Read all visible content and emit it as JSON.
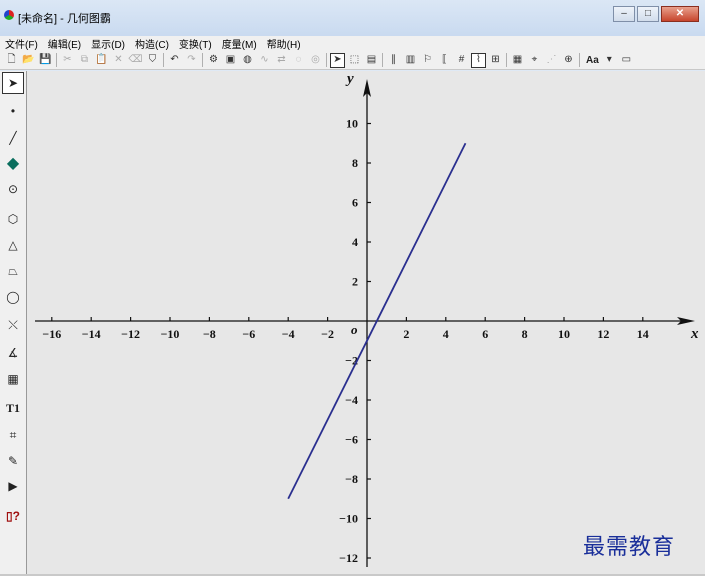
{
  "window": {
    "title": "[未命名] - 几何图霸",
    "minimize_glyph": "–",
    "maximize_glyph": "□",
    "close_glyph": "✕"
  },
  "menu": [
    {
      "label": "文件(F)"
    },
    {
      "label": "编辑(E)"
    },
    {
      "label": "显示(D)"
    },
    {
      "label": "构造(C)"
    },
    {
      "label": "变换(T)"
    },
    {
      "label": "度量(M)"
    },
    {
      "label": "帮助(H)"
    }
  ],
  "toolbar": {
    "font_button_label": "Aa",
    "groups": [
      [
        {
          "name": "new-file-icon",
          "glyph": "🗋"
        },
        {
          "name": "open-file-icon",
          "glyph": "📂"
        },
        {
          "name": "save-icon",
          "glyph": "💾"
        }
      ],
      [
        {
          "name": "cut-icon",
          "glyph": "✂",
          "disabled": true
        },
        {
          "name": "copy-icon",
          "glyph": "⧉",
          "disabled": true
        },
        {
          "name": "paste-icon",
          "glyph": "📋",
          "disabled": true
        },
        {
          "name": "delete-icon",
          "glyph": "✕",
          "disabled": true
        },
        {
          "name": "eraser-icon",
          "glyph": "⌫",
          "disabled": true
        },
        {
          "name": "shield-icon",
          "glyph": "⛉"
        }
      ],
      [
        {
          "name": "undo-icon",
          "glyph": "↶"
        },
        {
          "name": "redo-icon",
          "glyph": "↷",
          "disabled": true
        }
      ],
      [
        {
          "name": "gear-icon",
          "glyph": "⚙"
        },
        {
          "name": "image-settings-icon",
          "glyph": "▣"
        },
        {
          "name": "animate-icon",
          "glyph": "◍"
        },
        {
          "name": "trace-icon",
          "glyph": "∿",
          "disabled": true
        },
        {
          "name": "movement-icon",
          "glyph": "⇄",
          "disabled": true
        },
        {
          "name": "hide-icon",
          "glyph": "◌",
          "disabled": true
        },
        {
          "name": "show-icon",
          "glyph": "◎",
          "disabled": true
        }
      ],
      [
        {
          "name": "select-arrow-icon",
          "glyph": "➤",
          "active": true
        },
        {
          "name": "select-region-icon",
          "glyph": "⬚"
        },
        {
          "name": "select-all-icon",
          "glyph": "▤"
        }
      ],
      [
        {
          "name": "parallel-lines-icon",
          "glyph": "∥"
        },
        {
          "name": "page-icon",
          "glyph": "▥"
        },
        {
          "name": "label-icon",
          "glyph": "⚐"
        },
        {
          "name": "bracket-icon",
          "glyph": "⟦"
        },
        {
          "name": "number-icon",
          "glyph": "#"
        },
        {
          "name": "function-graph-icon",
          "glyph": "⌇",
          "active": true
        },
        {
          "name": "grid-icon",
          "glyph": "⊞"
        }
      ],
      [
        {
          "name": "calculator-icon",
          "glyph": "▦"
        },
        {
          "name": "coordinate-icon",
          "glyph": "⌖"
        },
        {
          "name": "dotted-line-icon",
          "glyph": "⋰",
          "disabled": true
        },
        {
          "name": "locus-icon",
          "glyph": "⊕"
        }
      ],
      [
        {
          "name": "dropdown-arrow-icon",
          "glyph": "▾"
        },
        {
          "name": "window-icon",
          "glyph": "▭"
        }
      ]
    ]
  },
  "sidebar_tools": [
    {
      "name": "select-tool-icon",
      "glyph": "➤",
      "active": true
    },
    {
      "name": "point-tool-icon",
      "glyph": "•"
    },
    {
      "name": "line-tool-icon",
      "glyph": "╱"
    },
    {
      "name": "polygon-tool-icon",
      "glyph": "◆"
    },
    {
      "name": "circle-tool-icon",
      "glyph": "⊙"
    },
    {
      "name": "cube-tool-icon",
      "glyph": "⬡"
    },
    {
      "name": "pyramid-tool-icon",
      "glyph": "△"
    },
    {
      "name": "prism-tool-icon",
      "glyph": "⏢"
    },
    {
      "name": "sphere-tool-icon",
      "glyph": "◯"
    },
    {
      "name": "transform-tool-icon",
      "glyph": "⤬"
    },
    {
      "name": "angle-tool-icon",
      "glyph": "∡"
    },
    {
      "name": "calculator-tool-icon",
      "glyph": "▦"
    },
    {
      "name": "text-tool-icon",
      "glyph": "T1"
    },
    {
      "name": "measure-tool-icon",
      "glyph": "⌗"
    },
    {
      "name": "pencil-tool-icon",
      "glyph": "✎"
    },
    {
      "name": "play-tool-icon",
      "glyph": "▶"
    },
    {
      "name": "help-tool-icon",
      "glyph": "▯?"
    }
  ],
  "graph": {
    "x_axis_label": "x",
    "y_axis_label": "y",
    "origin_label": "o",
    "x_ticks": [
      -16,
      -14,
      -12,
      -10,
      -8,
      -6,
      -4,
      -2,
      2,
      4,
      6,
      8,
      10,
      12,
      14
    ],
    "y_ticks": [
      10,
      8,
      6,
      4,
      2,
      -2,
      -4,
      -6,
      -8,
      -10,
      -12
    ],
    "line": {
      "x_start": -4,
      "y_start": -9,
      "x_end": 5,
      "y_end": 9,
      "color": "#2a2f8f"
    }
  },
  "watermark": "最需教育"
}
